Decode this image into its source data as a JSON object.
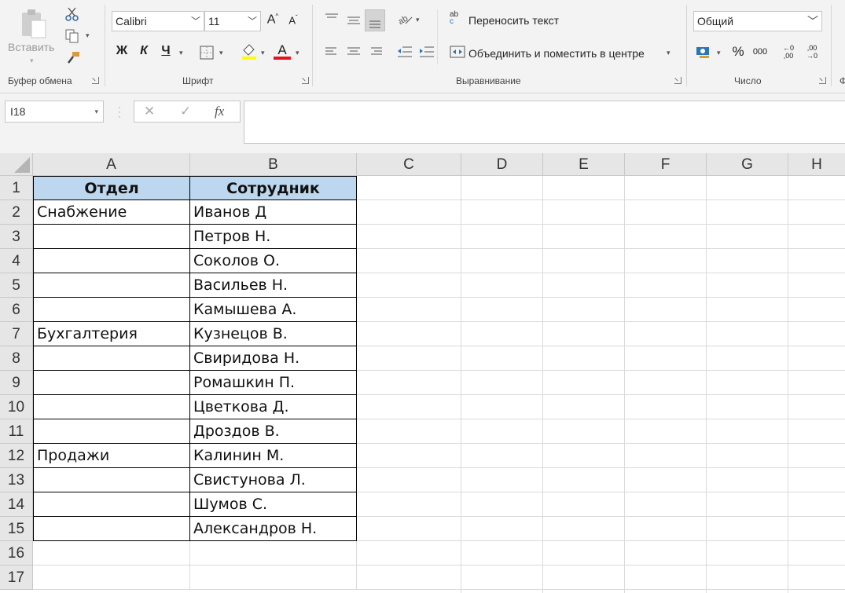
{
  "ribbon": {
    "clipboard": {
      "paste_label": "Вставить",
      "group_label": "Буфер обмена"
    },
    "font": {
      "name": "Calibri",
      "size": "11",
      "grow": "A",
      "shrink": "A",
      "bold": "Ж",
      "italic": "К",
      "underline": "Ч",
      "font_color_letter": "A",
      "font_color": "#e81123",
      "group_label": "Шрифт"
    },
    "alignment": {
      "wrap_text": "Переносить текст",
      "merge_center": "Объединить и поместить в центре",
      "group_label": "Выравнивание",
      "wrap_icon_top": "ab",
      "wrap_icon_bottom": "c"
    },
    "number": {
      "format": "Общий",
      "percent": "%",
      "thousands": "000",
      "inc_decimal_top": "←0",
      "inc_decimal_bottom": ",00",
      "dec_decimal_top": ",00",
      "dec_decimal_bottom": "→0",
      "group_label": "Число"
    },
    "next_group_hint": "Ф"
  },
  "formula_bar": {
    "name_box": "I18",
    "cancel": "✕",
    "enter": "✓",
    "fx": "fx",
    "formula": ""
  },
  "sheet": {
    "columns": [
      "A",
      "B",
      "C",
      "D",
      "E",
      "F",
      "G",
      "H"
    ],
    "rows": [
      "1",
      "2",
      "3",
      "4",
      "5",
      "6",
      "7",
      "8",
      "9",
      "10",
      "11",
      "12",
      "13",
      "14",
      "15",
      "16",
      "17"
    ],
    "header_fill": "#bdd7ee",
    "cells": {
      "A1": "Отдел",
      "B1": "Сотрудник",
      "A2": "Снабжение",
      "B2": "Иванов Д",
      "B3": "Петров Н.",
      "B4": "Соколов О.",
      "B5": "Васильев Н.",
      "B6": "Камышева А.",
      "A7": "Бухгалтерия",
      "B7": "Кузнецов В.",
      "B8": "Свиридова Н.",
      "B9": "Ромашкин П.",
      "B10": "Цветкова Д.",
      "B11": "Дроздов В.",
      "A12": "Продажи",
      "B12": "Калинин М.",
      "B13": "Свистунова Л.",
      "B14": "Шумов С.",
      "B15": "Александров Н."
    }
  }
}
